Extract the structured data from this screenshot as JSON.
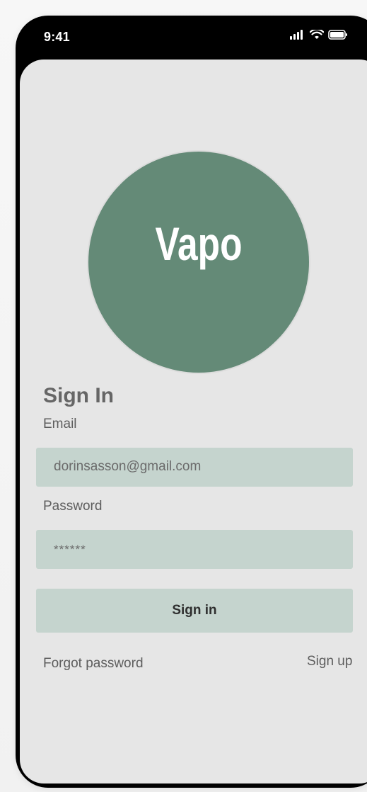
{
  "status_bar": {
    "time": "9:41",
    "icons": [
      "signal-icon",
      "wifi-icon",
      "battery-icon"
    ]
  },
  "logo": {
    "text": "Vapo",
    "background_color": "#648a77"
  },
  "sign_in": {
    "title": "Sign In",
    "email_label": "Email",
    "email_value": "dorinsasson@gmail.com",
    "password_label": "Password",
    "password_value": "******",
    "button_label": "Sign in",
    "forgot_password": "Forgot password",
    "sign_up": "Sign up"
  },
  "colors": {
    "screen_background": "#e6e6e6",
    "field_background": "#c5d4ce",
    "text": "#5e5e5e",
    "button_text": "#2f2f2f"
  }
}
